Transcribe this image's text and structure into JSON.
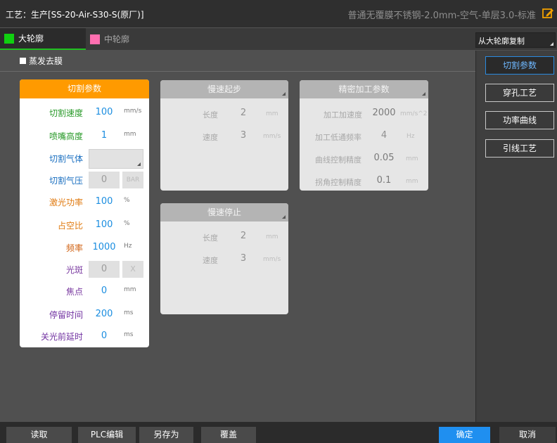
{
  "title": {
    "process": "工艺：生产[SS-20-Air-S30-S(原厂)]",
    "material": "普通无覆膜不锈钢-2.0mm-空气-单层3.0-标准"
  },
  "tabs": [
    {
      "label": "大轮廓",
      "color": "#10d010"
    },
    {
      "label": "中轮廓",
      "color": "#ff6fb0"
    }
  ],
  "copy_select": {
    "value": "从大轮廓复制"
  },
  "evaporation": {
    "label": "蒸发去膜",
    "checked": false
  },
  "side_buttons": {
    "cut_params": "切割参数",
    "pierce": "穿孔工艺",
    "power_curve": "功率曲线",
    "lead": "引线工艺"
  },
  "cut_panel": {
    "title": "切割参数",
    "rows": [
      {
        "label": "切割速度",
        "value": "100",
        "unit": "mm/s"
      },
      {
        "label": "喷嘴高度",
        "value": "1",
        "unit": "mm"
      },
      {
        "label": "切割气体",
        "value": "",
        "unit": ""
      },
      {
        "label": "切割气压",
        "value": "0",
        "unit": "BAR"
      },
      {
        "label": "激光功率",
        "value": "100",
        "unit": "%"
      },
      {
        "label": "占空比",
        "value": "100",
        "unit": "%"
      },
      {
        "label": "频率",
        "value": "1000",
        "unit": "Hz"
      },
      {
        "label": "光斑",
        "value": "0",
        "unit": "X"
      },
      {
        "label": "焦点",
        "value": "0",
        "unit": "mm"
      },
      {
        "label": "停留时间",
        "value": "200",
        "unit": "ms"
      },
      {
        "label": "关光前延时",
        "value": "0",
        "unit": "ms"
      }
    ]
  },
  "slow_start": {
    "title": "慢速起步",
    "rows": [
      {
        "label": "长度",
        "value": "2",
        "unit": "mm"
      },
      {
        "label": "速度",
        "value": "3",
        "unit": "mm/s"
      }
    ]
  },
  "slow_stop": {
    "title": "慢速停止",
    "rows": [
      {
        "label": "长度",
        "value": "2",
        "unit": "mm"
      },
      {
        "label": "速度",
        "value": "3",
        "unit": "mm/s"
      }
    ]
  },
  "precise": {
    "title": "精密加工参数",
    "rows": [
      {
        "label": "加工加速度",
        "value": "2000",
        "unit": "mm/s^2"
      },
      {
        "label": "加工低通频率",
        "value": "4",
        "unit": "Hz"
      },
      {
        "label": "曲线控制精度",
        "value": "0.05",
        "unit": "mm"
      },
      {
        "label": "拐角控制精度",
        "value": "0.1",
        "unit": "mm"
      }
    ]
  },
  "bottom": {
    "read": "读取",
    "plc": "PLC编辑",
    "save_as": "另存为",
    "cover": "覆盖",
    "ok": "确定",
    "cancel": "取消"
  }
}
